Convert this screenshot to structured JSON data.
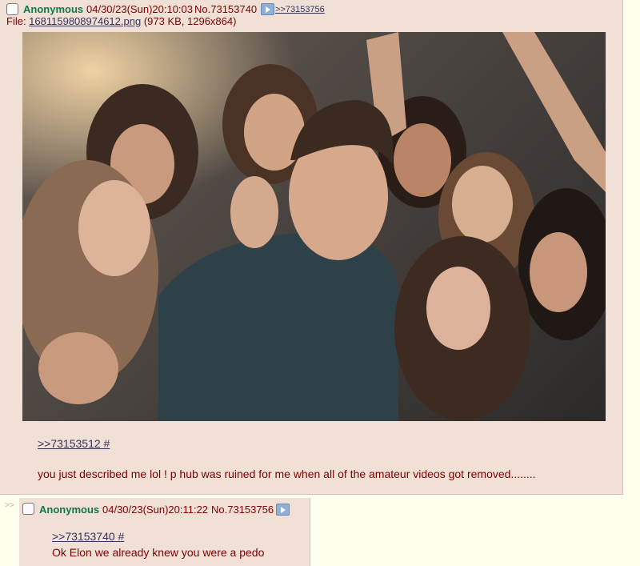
{
  "post1": {
    "name": "Anonymous",
    "datetime": "04/30/23(Sun)20:10:03",
    "no_label": "No.73153740",
    "backlink": ">>73153756",
    "file_prefix": "File: ",
    "file_name": "1681159808974612.png",
    "file_meta": " (973 KB, 1296x864)",
    "quote_link": ">>73153512 #",
    "message": "you just described me lol ! p hub was ruined for me when all of the amateur videos got removed........"
  },
  "post2": {
    "side_arrows": ">>",
    "name": "Anonymous",
    "datetime": "04/30/23(Sun)20:11:22",
    "no_label": "No.73153756",
    "quote_link": ">>73153740 #",
    "message": "Ok Elon we already knew you were a pedo"
  },
  "colors": {
    "page_bg": "#ffffee",
    "post_bg": "#f0e0d6",
    "name": "#117743",
    "text": "#800000",
    "link": "#34345c"
  },
  "icons": [
    "checkbox-icon",
    "play-arrow-icon"
  ]
}
